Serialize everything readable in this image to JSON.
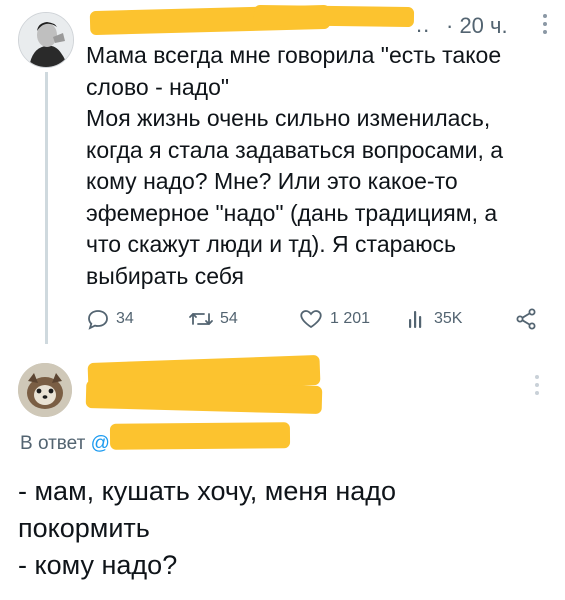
{
  "tweet": {
    "timestamp": "· 20 ч.",
    "author_tail": "..",
    "lines": [
      "Мама всегда мне говорила \"есть такое",
      "слово - надо\"",
      "Моя жизнь очень сильно изменилась,",
      "когда я стала задаваться вопросами, а",
      "кому надо? Мне? Или это какое-то",
      "эфемерное \"надо\" (дань традициям, а",
      "что скажут люди и тд). Я стараюсь",
      "выбирать себя"
    ],
    "actions": {
      "replies": "34",
      "retweets": "54",
      "likes": "1 201",
      "views": "35K"
    },
    "icons": [
      "reply-icon",
      "retweet-icon",
      "like-icon",
      "views-icon",
      "share-icon",
      "more-icon"
    ]
  },
  "reply": {
    "reply_to_label": "В ответ",
    "reply_to_handle": "@",
    "lines": [
      "- мам, кушать хочу, меня надо",
      "покормить",
      "- кому надо?"
    ]
  },
  "colors": {
    "text": "#0f1419",
    "muted": "#536471",
    "link": "#1d9bf0",
    "redaction": "#fcc32f",
    "thread_line": "#cfd9de"
  }
}
